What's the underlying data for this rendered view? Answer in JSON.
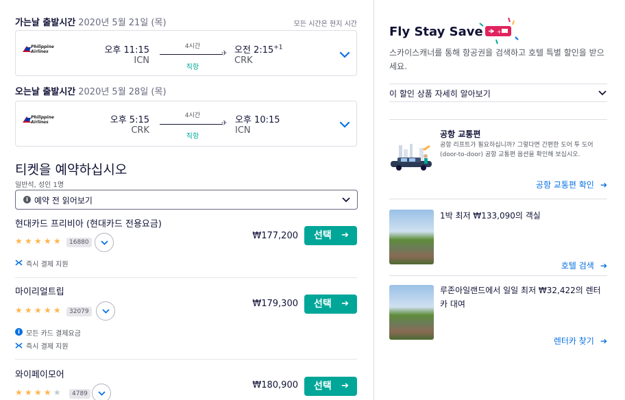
{
  "outbound": {
    "label": "가는날 출발시간",
    "date": "2020년 5월 21일 (목)",
    "airline_logo_text": "Philippine Airlines",
    "depart_time": "오후 11:15",
    "depart_code": "ICN",
    "duration": "4시간",
    "stops": "직항",
    "arrive_time": "오전 2:15",
    "arrive_plus": "+1",
    "arrive_code": "CRK"
  },
  "local_time_note": "모든 시간은 현지 시간",
  "inbound": {
    "label": "오는날 출발시간",
    "date": "2020년 5월 28일 (목)",
    "airline_logo_text": "Philippine Airlines",
    "depart_time": "오후 5:15",
    "depart_code": "CRK",
    "duration": "4시간",
    "stops": "직항",
    "arrive_time": "오후 10:15",
    "arrive_code": "ICN"
  },
  "booking": {
    "heading": "티켓을 예약하십시오",
    "cabin": "일반석, 성인 1명",
    "read_before": "예약 전 읽어보기",
    "select_label": "선택",
    "providers": [
      {
        "name": "현대카드 프리비아 (현대카드 전용요금)",
        "stars": 5,
        "review_count": "16880",
        "price": "₩177,200",
        "features": [
          "즉시 결제 지원"
        ]
      },
      {
        "name": "마이리얼트립",
        "stars": 5,
        "review_count": "32079",
        "price": "₩179,300",
        "features": [
          "모든 카드 결제요금",
          "즉시 결제 지원"
        ]
      },
      {
        "name": "와이페이모어",
        "stars": 4,
        "review_count": "4789",
        "price": "₩180,900",
        "features": []
      }
    ]
  },
  "sidebar": {
    "title": "Fly Stay Save",
    "description": "스카이스캐너를 통해 항공권을 검색하고 호텔 특별 할인을 받으세요.",
    "learn_more": "이 할인 상품 자세히 알아보기",
    "airport_transfer": {
      "title": "공항 교통편",
      "description": "공항 리프트가 필요하십니까? 그렇다면 간편한 도어 투 도어(door-to-door) 공항 교통편 옵션을 확인해 보십시오.",
      "link": "공항 교통편 확인"
    },
    "hotel": {
      "title": "1박 최저 ₩133,090의 객실",
      "link": "호텔 검색"
    },
    "car": {
      "title": "루존아일랜드에서 일일 최저 ₩32,422의 렌터카 대여",
      "link": "렌터카 찾기"
    }
  },
  "colors": {
    "accent_green": "#00a698",
    "link_blue": "#0770e3",
    "star": "#ffb54d",
    "badge_pink": "#e0245e"
  }
}
